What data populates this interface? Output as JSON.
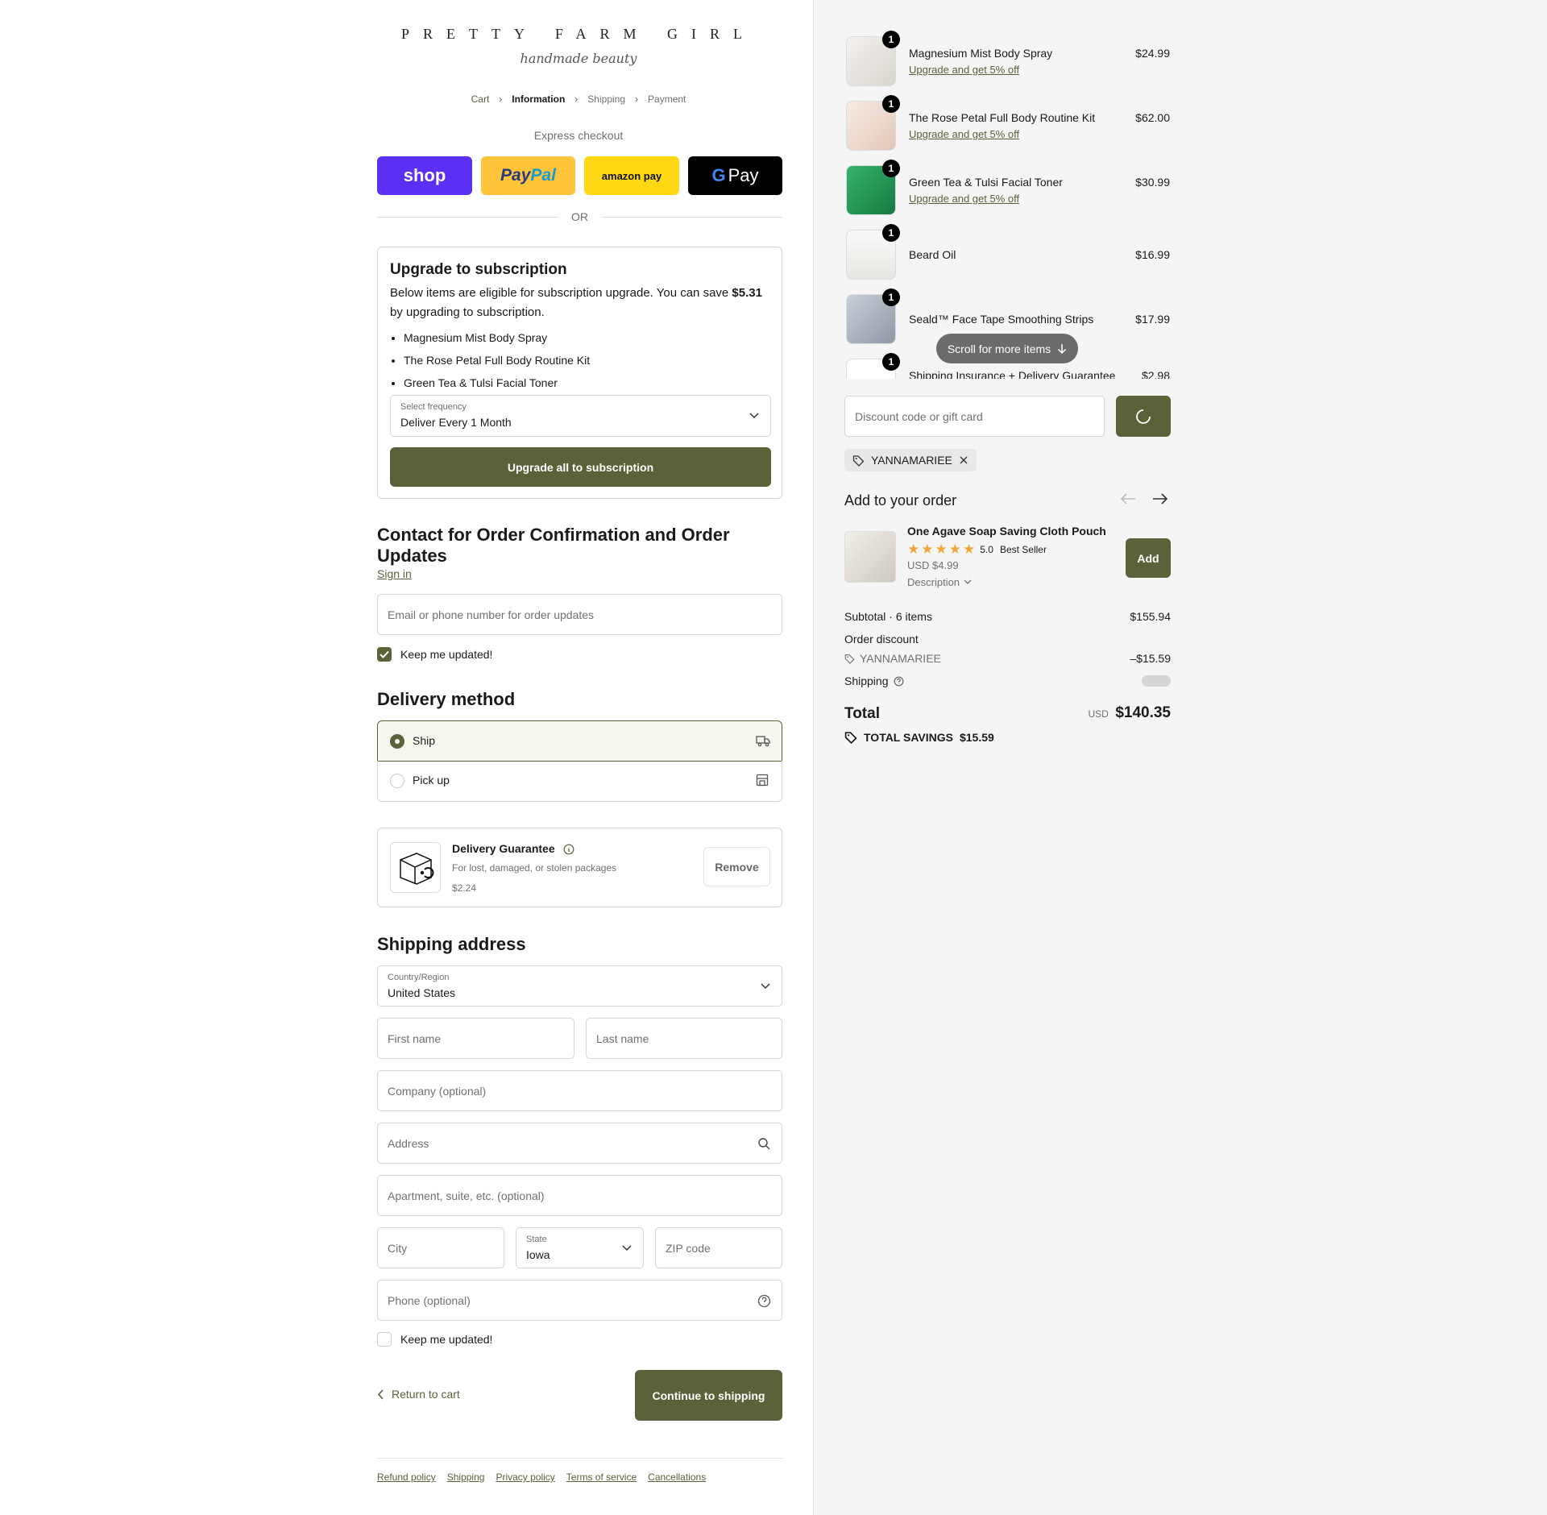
{
  "brand": {
    "name": "PRETTY FARM GIRL",
    "tagline": "handmade beauty"
  },
  "breadcrumb": {
    "cart": "Cart",
    "information": "Information",
    "shipping": "Shipping",
    "payment": "Payment"
  },
  "express": {
    "title": "Express checkout",
    "shop": "shop",
    "paypal_a": "Pay",
    "paypal_b": "Pal",
    "amazon": "amazon pay",
    "gpay": "Pay",
    "or": "OR"
  },
  "subscription": {
    "title": "Upgrade to subscription",
    "desc_a": "Below items are eligible for subscription upgrade. You can save",
    "save_amount": "$5.31",
    "desc_b": "by upgrading to subscription.",
    "items": [
      "Magnesium Mist Body Spray",
      "The Rose Petal Full Body Routine Kit",
      "Green Tea & Tulsi Facial Toner"
    ],
    "freq_label": "Select frequency",
    "freq_value": "Deliver Every 1 Month",
    "button": "Upgrade all to subscription"
  },
  "contact": {
    "title": "Contact for Order Confirmation and Order Updates",
    "sign_in": "Sign in",
    "email_placeholder": "Email or phone number for order updates",
    "keep_updated": "Keep me updated!"
  },
  "delivery": {
    "title": "Delivery method",
    "ship": "Ship",
    "pickup": "Pick up"
  },
  "guarantee": {
    "title": "Delivery Guarantee",
    "desc": "For lost, damaged, or stolen packages",
    "price": "$2.24",
    "remove": "Remove"
  },
  "shipping_address": {
    "title": "Shipping address",
    "country_label": "Country/Region",
    "country_value": "United States",
    "first_name": "First name",
    "last_name": "Last name",
    "company": "Company (optional)",
    "address": "Address",
    "apartment": "Apartment, suite, etc. (optional)",
    "city": "City",
    "state_label": "State",
    "state_value": "Iowa",
    "zip": "ZIP code",
    "phone": "Phone (optional)",
    "keep_updated": "Keep me updated!"
  },
  "nav": {
    "return": "Return to cart",
    "continue": "Continue to shipping"
  },
  "footer": {
    "links": [
      "Refund policy",
      "Shipping",
      "Privacy policy",
      "Terms of service",
      "Cancellations"
    ]
  },
  "cart": {
    "items": [
      {
        "name": "Magnesium Mist Body Spray",
        "price": "$24.99",
        "qty": "1",
        "upgrade": "Upgrade and get 5% off"
      },
      {
        "name": "The Rose Petal Full Body Routine Kit",
        "price": "$62.00",
        "qty": "1",
        "upgrade": "Upgrade and get 5% off"
      },
      {
        "name": "Green Tea & Tulsi Facial Toner",
        "price": "$30.99",
        "qty": "1",
        "upgrade": "Upgrade and get 5% off"
      },
      {
        "name": "Beard Oil",
        "price": "$16.99",
        "qty": "1"
      },
      {
        "name": "Seald™ Face Tape Smoothing Strips",
        "price": "$17.99",
        "qty": "1"
      },
      {
        "name": "Shipping Insurance + Delivery Guarantee",
        "price": "$2.98",
        "qty": "1"
      }
    ],
    "scroll_hint": "Scroll for more items"
  },
  "discount": {
    "placeholder": "Discount code or gift card",
    "code": "YANNAMARIEE"
  },
  "upsell": {
    "title": "Add to your order",
    "product": "One Agave Soap Saving Cloth Pouch",
    "rating": "5.0",
    "rating_stars": 5,
    "best_seller": "Best Seller",
    "price": "USD $4.99",
    "description": "Description",
    "add": "Add"
  },
  "summary": {
    "subtotal_label": "Subtotal · 6 items",
    "subtotal": "$155.94",
    "order_discount": "Order discount",
    "discount_code": "YANNAMARIEE",
    "discount_amount": "–$15.59",
    "shipping_label": "Shipping",
    "total_label": "Total",
    "currency": "USD",
    "total": "$140.35",
    "savings_label": "TOTAL SAVINGS",
    "savings": "$15.59"
  },
  "colors": {
    "accent": "#5b6139",
    "shop_pay": "#5a31f4",
    "paypal": "#ffc439",
    "amazon": "#ffd814",
    "gpay": "#000000"
  }
}
